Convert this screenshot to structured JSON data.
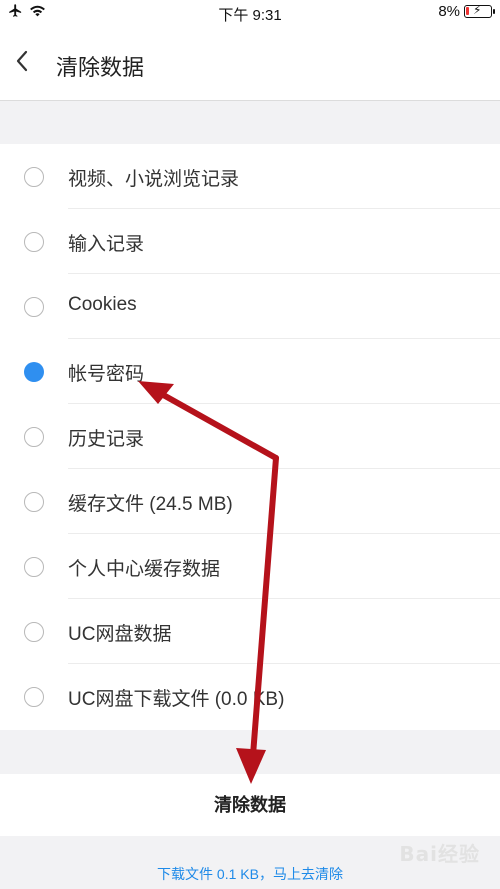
{
  "status_bar": {
    "time": "下午 9:31",
    "battery": "8%",
    "airplane_icon": "airplane-icon",
    "wifi_icon": "wifi-icon"
  },
  "nav": {
    "back_icon": "chevron-left-icon",
    "title": "清除数据"
  },
  "options": [
    {
      "label": "视频、小说浏览记录",
      "checked": false
    },
    {
      "label": "输入记录",
      "checked": false
    },
    {
      "label": "Cookies",
      "checked": false
    },
    {
      "label": "帐号密码",
      "checked": true
    },
    {
      "label": "历史记录",
      "checked": false
    },
    {
      "label": "缓存文件 (24.5 MB)",
      "checked": false
    },
    {
      "label": "个人中心缓存数据",
      "checked": false
    },
    {
      "label": "UC网盘数据",
      "checked": false
    },
    {
      "label": "UC网盘下载文件 (0.0 KB)",
      "checked": false
    }
  ],
  "clear_button": {
    "label": "清除数据"
  },
  "footer": {
    "link_text": "下载文件 0.1 KB，马上去清除"
  },
  "watermark": {
    "text": "Bai经验"
  },
  "colors": {
    "accent": "#2f8ff0",
    "link": "#1e8ae8",
    "annotation_arrow": "#b5121b"
  }
}
